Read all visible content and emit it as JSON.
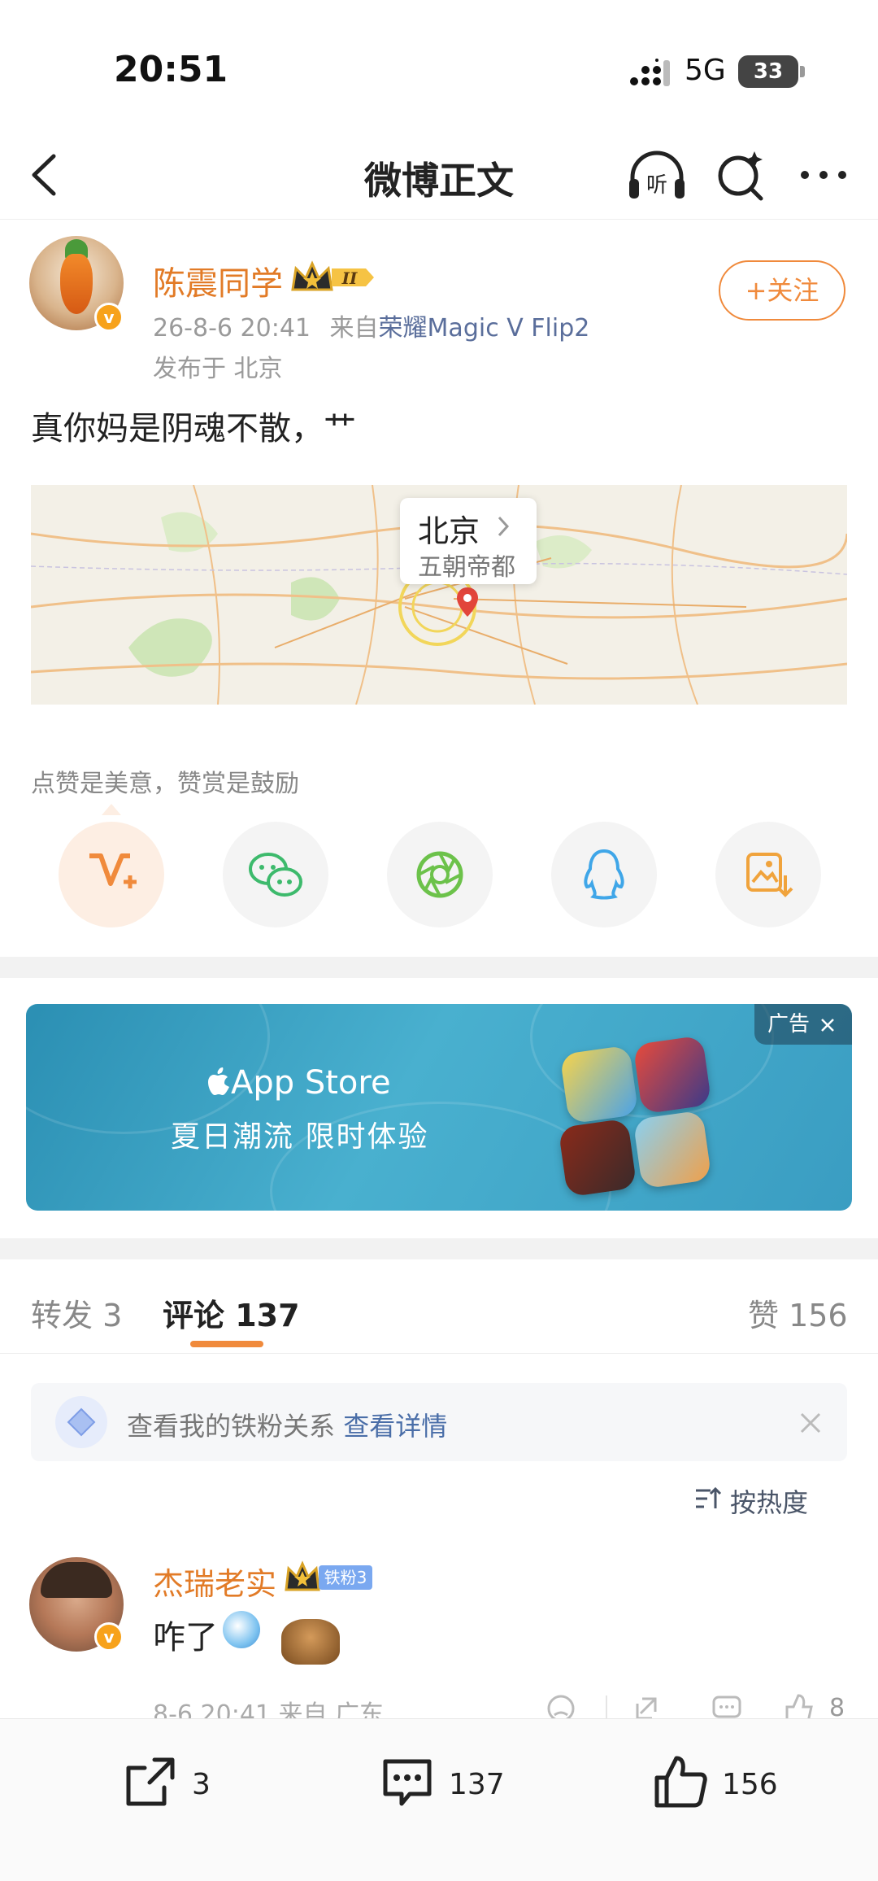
{
  "status_bar": {
    "time": "20:51",
    "network": "5G",
    "battery": "33"
  },
  "nav": {
    "title": "微博正文",
    "listen_label": "听"
  },
  "post": {
    "author": "陈震同学",
    "rank_badge": "II",
    "timestamp": "26-8-6 20:41",
    "source_prefix": "来自",
    "source_device": "荣耀Magic V Flip2",
    "location_label": "发布于 北京",
    "follow_label": "+关注",
    "text": "真你妈是阴魂不散，艹",
    "map": {
      "city": "北京",
      "description": "五朝帝都"
    },
    "praise_hint": "点赞是美意，赞赏是鼓励",
    "share_actions": [
      "reward",
      "wechat",
      "moments",
      "qq",
      "save-image"
    ]
  },
  "ad": {
    "brand": "App Store",
    "slogan": "夏日潮流 限时体验",
    "tag": "广告"
  },
  "tabs": {
    "repost": "转发 3",
    "comment": "评论 137",
    "like": "赞 156"
  },
  "iron_fan": {
    "text": "查看我的铁粉关系",
    "link": "查看详情"
  },
  "sort": {
    "label": "按热度"
  },
  "comments": [
    {
      "name": "杰瑞老实",
      "fan_badge": "铁粉3",
      "text": "咋了",
      "meta": "8-6 20:41 来自 广东",
      "likes": "8"
    }
  ],
  "bottom_bar": {
    "repost_count": "3",
    "comment_count": "137",
    "like_count": "156"
  },
  "colors": {
    "accent": "#f08a3c",
    "author_name": "#e27b27",
    "link": "#4a6ea8"
  }
}
